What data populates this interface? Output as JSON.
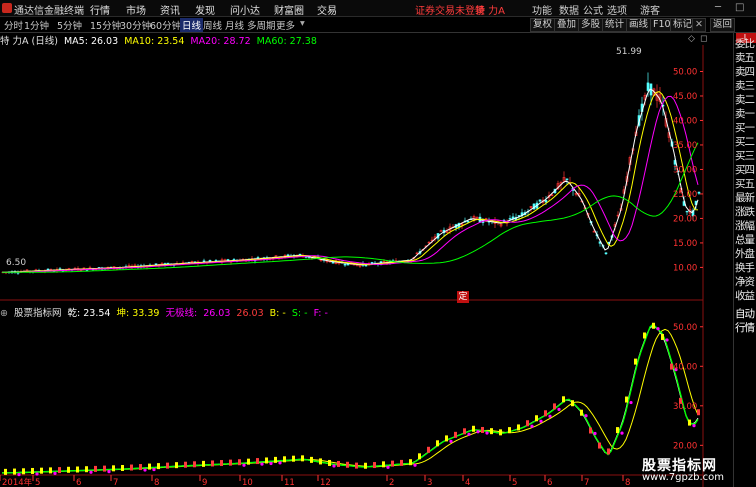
{
  "app": {
    "title": "通达信金融终端",
    "menus": [
      "行情",
      "市场",
      "资讯",
      "发现",
      "问小达",
      "财富圈",
      "交易"
    ],
    "status_warning": "证券交易未登录",
    "stock_label": "特 力A",
    "right_menus": [
      "功能",
      "数据",
      "公式",
      "选项"
    ],
    "user": "游客"
  },
  "toolbar": {
    "periods": [
      "分时",
      "1分钟",
      "5分钟",
      "15分钟",
      "30分钟",
      "60分钟",
      "日线",
      "周线",
      "月线",
      "多周期",
      "更多"
    ],
    "active_period": "日线",
    "tools": [
      "复权",
      "叠加",
      "多股",
      "统计",
      "画线",
      "F10",
      "标记",
      "返回"
    ]
  },
  "ma_bar": {
    "name": "特 力A (日线)",
    "ma5": "MA5: 26.03",
    "ma10": "MA10: 23.54",
    "ma20": "MA20: 28.72",
    "ma60": "MA60: 27.38"
  },
  "price_axis": [
    "50.00",
    "45.00",
    "40.00",
    "35.00",
    "30.00",
    "25.00",
    "20.00",
    "15.00",
    "10.00"
  ],
  "peak_label": "51.99",
  "low_label": "6.50",
  "ding_badge": "定",
  "indicator": {
    "name": "股票指标网",
    "qian": "乾: 23.54",
    "kun": "坤: 33.39",
    "wuji_label": "无极线:",
    "wuji": "26.03",
    "val4": "26.03",
    "b": "B: -",
    "s": "S: -",
    "f": "F: -",
    "axis": [
      "50.00",
      "40.00",
      "30.00",
      "20.00"
    ]
  },
  "date_axis": [
    "2014年",
    "5",
    "6",
    "7",
    "8",
    "9",
    "10",
    "11",
    "12",
    "2",
    "3",
    "4",
    "5",
    "6",
    "7",
    "8"
  ],
  "right_panel": {
    "top_badge": "L",
    "items": [
      "委比",
      "卖五",
      "卖四",
      "卖三",
      "卖二",
      "卖一",
      "买一",
      "买二",
      "买三",
      "买四",
      "买五",
      "最新",
      "涨跌",
      "涨幅",
      "总量",
      "外盘",
      "换手",
      "净资",
      "收益",
      "自动",
      "行情"
    ]
  },
  "watermark": {
    "line1": "股票指标网",
    "line2": "www.7gpzb.com"
  },
  "colors": {
    "ma5": "#ffffff",
    "ma10": "#ffff00",
    "ma20": "#ff00ff",
    "ma60": "#00ff00",
    "up": "#ff3232",
    "down": "#54ffff",
    "axis": "#ff3232"
  }
}
